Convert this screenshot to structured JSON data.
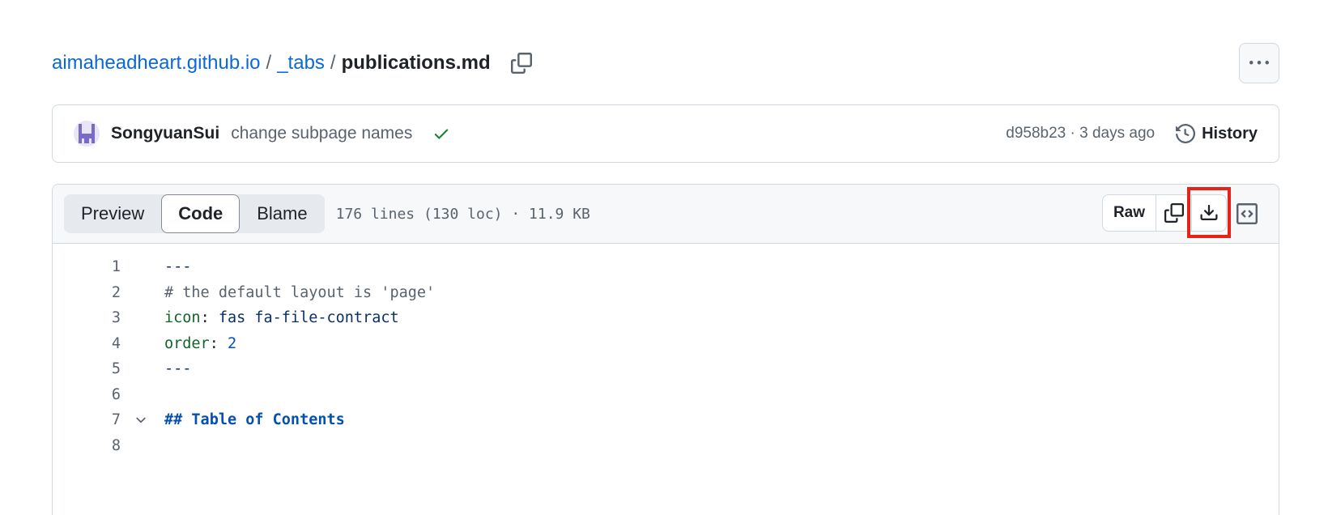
{
  "breadcrumb": {
    "repo": "aimaheadheart.github.io",
    "folder": "_tabs",
    "file": "publications.md",
    "separator": "/"
  },
  "icons": {
    "copy_path": "copy-icon",
    "more": "kebab-horizontal-icon",
    "check": "check-icon",
    "history": "history-icon",
    "copy_raw": "copy-icon",
    "download": "download-icon",
    "symbols": "code-square-icon",
    "fold": "chevron-down-icon"
  },
  "commit": {
    "author": "SongyuanSui",
    "message": "change subpage names",
    "sha_time": "d958b23 · 3 days ago",
    "history_label": "History"
  },
  "toolbar": {
    "tabs": [
      "Preview",
      "Code",
      "Blame"
    ],
    "active_tab": "Code",
    "file_info": "176 lines (130 loc) · 11.9 KB",
    "raw_label": "Raw"
  },
  "code_lines": [
    {
      "num": "1",
      "text": "---"
    },
    {
      "num": "2",
      "text": "# the default layout is 'page'"
    },
    {
      "num": "3",
      "key": "icon",
      "value": "fas fa-file-contract"
    },
    {
      "num": "4",
      "key": "order",
      "value": "2"
    },
    {
      "num": "5",
      "text": "---"
    },
    {
      "num": "6",
      "text": ""
    },
    {
      "num": "7",
      "text": "## Table of Contents"
    },
    {
      "num": "8",
      "text": ""
    }
  ],
  "colors": {
    "link": "#0969da",
    "success": "#1a7f37",
    "highlight_box": "#e5231b",
    "border": "#d1d9e0"
  }
}
